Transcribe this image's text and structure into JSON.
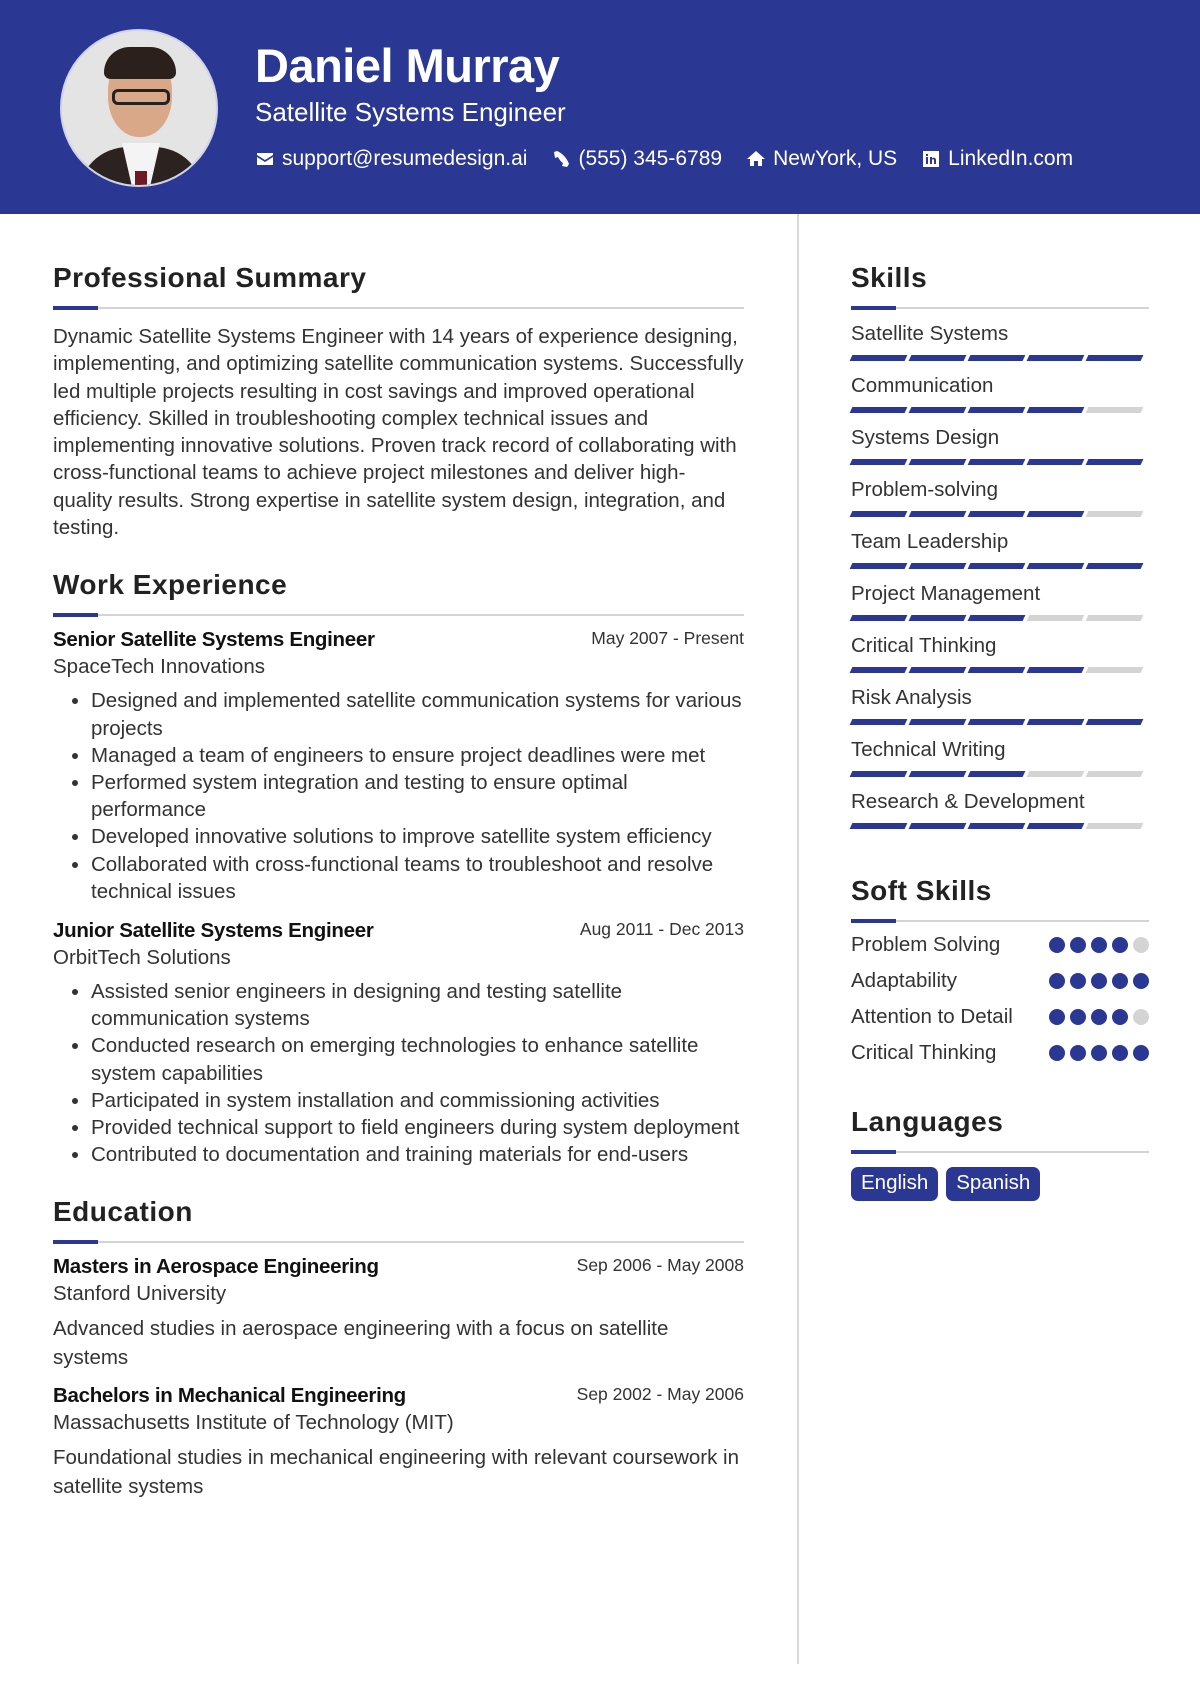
{
  "header": {
    "name": "Daniel Murray",
    "title": "Satellite Systems Engineer",
    "contacts": [
      {
        "icon": "envelope-icon",
        "text": "support@resumedesign.ai"
      },
      {
        "icon": "phone-icon",
        "text": "(555) 345-6789"
      },
      {
        "icon": "home-icon",
        "text": "NewYork, US"
      },
      {
        "icon": "linkedin-icon",
        "text": "LinkedIn.com"
      }
    ]
  },
  "colors": {
    "accent": "#2a3893",
    "inactive": "#d4d4d4"
  },
  "summary": {
    "heading": "Professional Summary",
    "text": "Dynamic Satellite Systems Engineer with 14 years of experience designing, implementing, and optimizing satellite communication systems. Successfully led multiple projects resulting in cost savings and improved operational efficiency. Skilled in troubleshooting complex technical issues and implementing innovative solutions. Proven track record of collaborating with cross-functional teams to achieve project milestones and deliver high-quality results. Strong expertise in satellite system design, integration, and testing."
  },
  "experience": {
    "heading": "Work Experience",
    "jobs": [
      {
        "title": "Senior Satellite Systems Engineer",
        "date": "May 2007 - Present",
        "company": "SpaceTech Innovations",
        "bullets": [
          "Designed and implemented satellite communication systems for various projects",
          "Managed a team of engineers to ensure project deadlines were met",
          "Performed system integration and testing to ensure optimal performance",
          "Developed innovative solutions to improve satellite system efficiency",
          "Collaborated with cross-functional teams to troubleshoot and resolve technical issues"
        ]
      },
      {
        "title": "Junior Satellite Systems Engineer",
        "date": "Aug 2011 - Dec 2013",
        "company": "OrbitTech Solutions",
        "bullets": [
          "Assisted senior engineers in designing and testing satellite communication systems",
          "Conducted research on emerging technologies to enhance satellite system capabilities",
          "Participated in system installation and commissioning activities",
          "Provided technical support to field engineers during system deployment",
          "Contributed to documentation and training materials for end-users"
        ]
      }
    ]
  },
  "education": {
    "heading": "Education",
    "items": [
      {
        "degree": "Masters in Aerospace Engineering",
        "date": "Sep 2006 - May 2008",
        "school": "Stanford University",
        "desc": "Advanced studies in aerospace engineering with a focus on satellite systems"
      },
      {
        "degree": "Bachelors in Mechanical Engineering",
        "date": "Sep 2002 - May 2006",
        "school": "Massachusetts Institute of Technology (MIT)",
        "desc": "Foundational studies in mechanical engineering with relevant coursework in satellite systems"
      }
    ]
  },
  "skills": {
    "heading": "Skills",
    "max": 5,
    "items": [
      {
        "name": "Satellite Systems",
        "level": 5
      },
      {
        "name": "Communication",
        "level": 4
      },
      {
        "name": "Systems Design",
        "level": 5
      },
      {
        "name": "Problem-solving",
        "level": 4
      },
      {
        "name": "Team Leadership",
        "level": 5
      },
      {
        "name": "Project Management",
        "level": 3
      },
      {
        "name": "Critical Thinking",
        "level": 4
      },
      {
        "name": "Risk Analysis",
        "level": 5
      },
      {
        "name": "Technical Writing",
        "level": 3
      },
      {
        "name": "Research & Development",
        "level": 4
      }
    ]
  },
  "soft_skills": {
    "heading": "Soft Skills",
    "max": 5,
    "items": [
      {
        "name": "Problem Solving",
        "level": 4
      },
      {
        "name": "Adaptability",
        "level": 5
      },
      {
        "name": "Attention to Detail",
        "level": 4
      },
      {
        "name": "Critical Thinking",
        "level": 5
      }
    ]
  },
  "languages": {
    "heading": "Languages",
    "items": [
      "English",
      "Spanish"
    ]
  }
}
